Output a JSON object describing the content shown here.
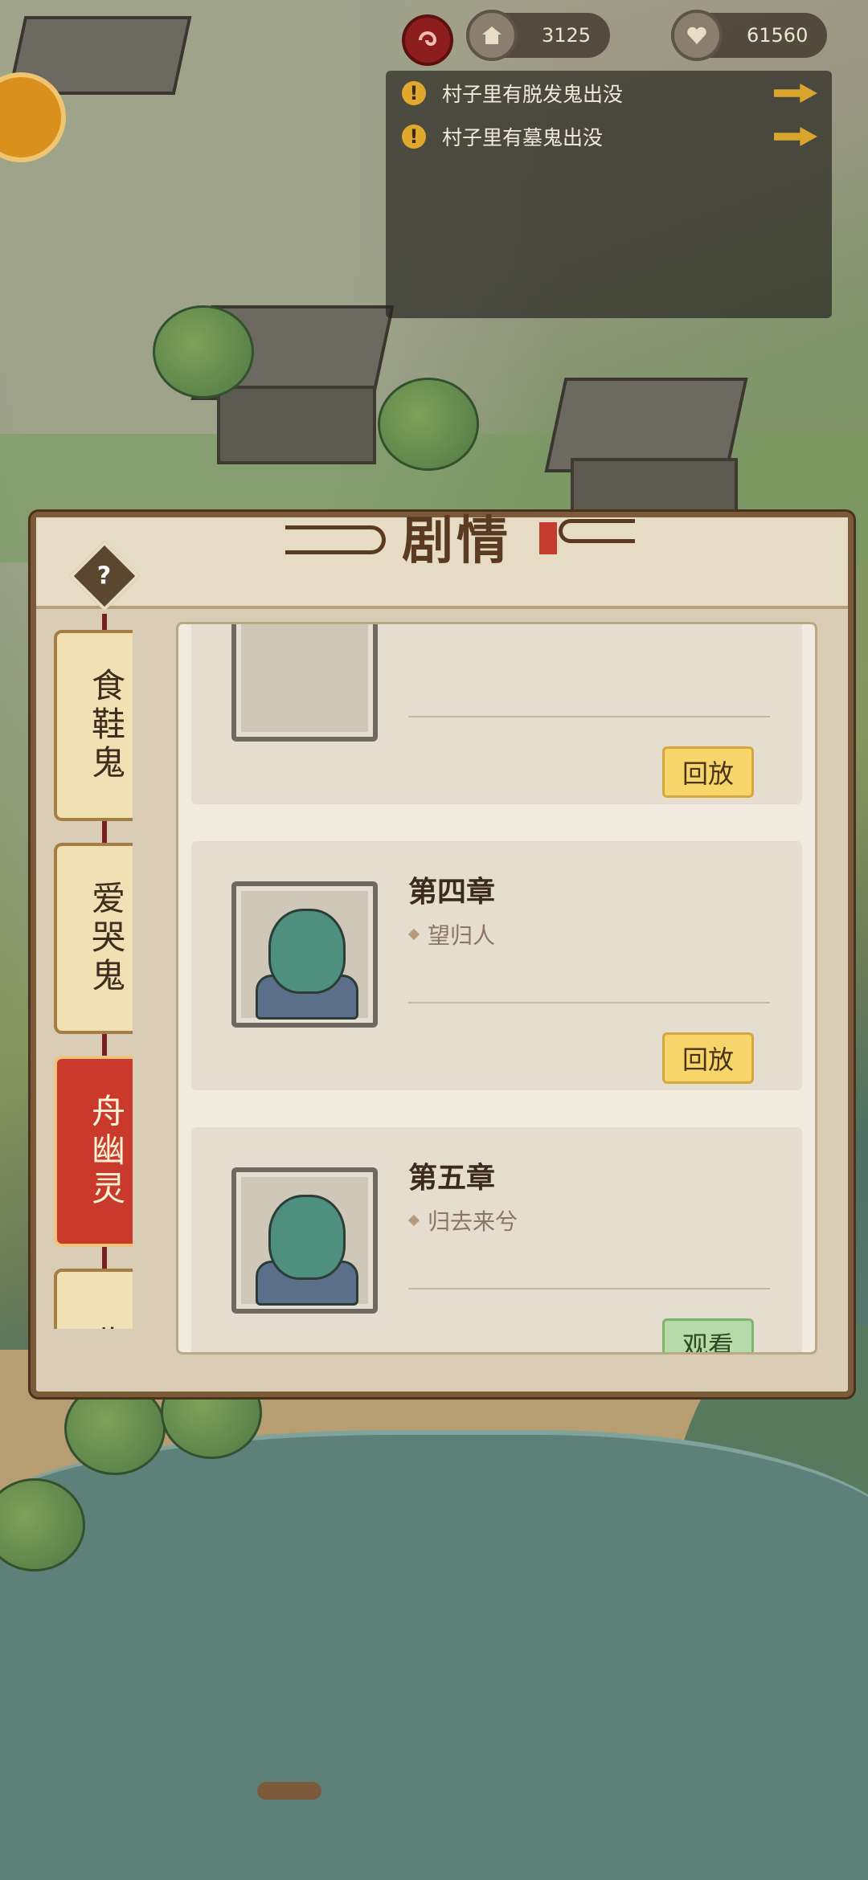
{
  "top_bar": {
    "resource1": {
      "icon": "house-icon",
      "value": "3125"
    },
    "resource2": {
      "icon": "heart-icon",
      "value": "61560"
    }
  },
  "notices": [
    {
      "text": "村子里有脱发鬼出没"
    },
    {
      "text": "村子里有墓鬼出没"
    }
  ],
  "panel": {
    "title": "剧情",
    "tabs": [
      {
        "label": "食鞋鬼",
        "active": false
      },
      {
        "label": "爱哭鬼",
        "active": false
      },
      {
        "label": "舟幽灵",
        "active": true
      },
      {
        "label": "收菜",
        "active": false
      }
    ],
    "chapters": [
      {
        "title": "",
        "subtitle": "",
        "button": "回放",
        "button_type": "replay"
      },
      {
        "title": "第四章",
        "subtitle": "望归人",
        "button": "回放",
        "button_type": "replay"
      },
      {
        "title": "第五章",
        "subtitle": "归去来兮",
        "button": "观看",
        "button_type": "watch"
      }
    ]
  }
}
